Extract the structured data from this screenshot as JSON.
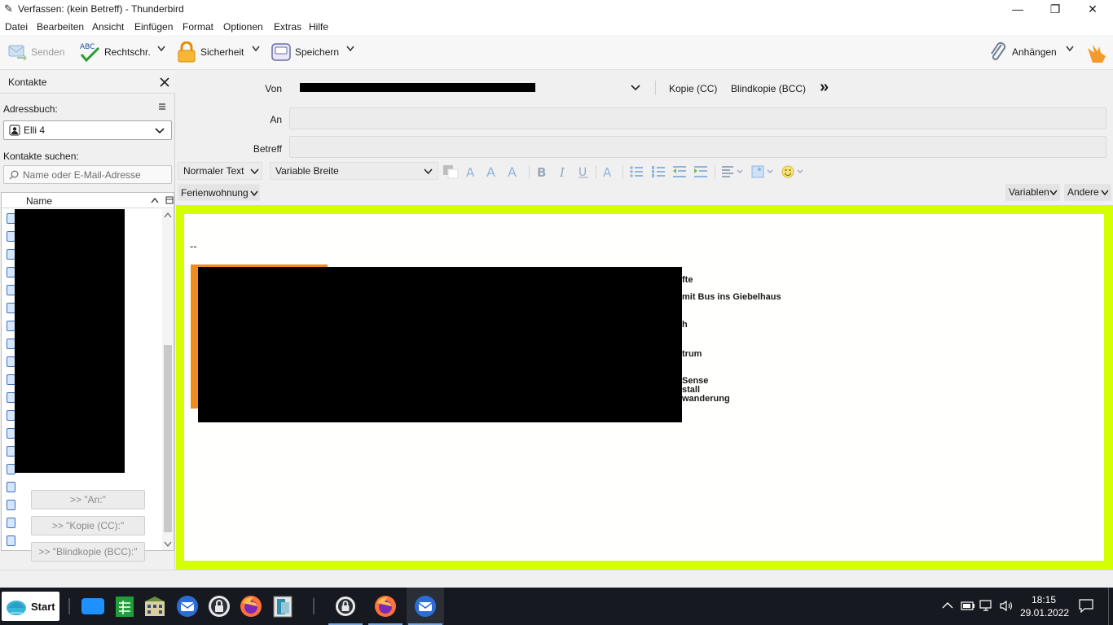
{
  "window": {
    "title": "Verfassen: (kein Betreff) - Thunderbird",
    "minimize": "—",
    "maximize": "❐",
    "close": "✕"
  },
  "menu": [
    "Datei",
    "Bearbeiten",
    "Ansicht",
    "Einfügen",
    "Format",
    "Optionen",
    "Extras",
    "Hilfe"
  ],
  "toolbar": {
    "send": "Senden",
    "spell": "Rechtschr.",
    "spell_icon_text": "ABC",
    "security": "Sicherheit",
    "save": "Speichern",
    "attach": "Anhängen"
  },
  "sidebar": {
    "title": "Kontakte",
    "addressbook_label": "Adressbuch:",
    "addressbook_value": "Elli 4",
    "search_label": "Kontakte suchen:",
    "search_placeholder": "Name oder E-Mail-Adresse",
    "column_name": "Name",
    "add_to": ">> \"An:\"",
    "add_cc": ">> \"Kopie (CC):\"",
    "add_bcc": ">> \"Blindkopie (BCC):\""
  },
  "compose": {
    "from_label": "Von",
    "cc_button": "Kopie (CC)",
    "bcc_button": "Blindkopie (BCC)",
    "more_icon": "»",
    "to_label": "An",
    "subject_label": "Betreff"
  },
  "format": {
    "paragraph": "Normaler Text",
    "font": "Variable Breite",
    "template": "Ferienwohnung",
    "variables": "Variablen",
    "other": "Andere"
  },
  "editor": {
    "signature_sep": "--",
    "sig_lines": [
      "fte",
      "mit Bus ins Giebelhaus",
      "h",
      "trum",
      "Sense",
      "stall",
      "wanderung"
    ]
  },
  "taskbar": {
    "start": "Start",
    "time": "18:15",
    "date": "29.01.2022"
  }
}
